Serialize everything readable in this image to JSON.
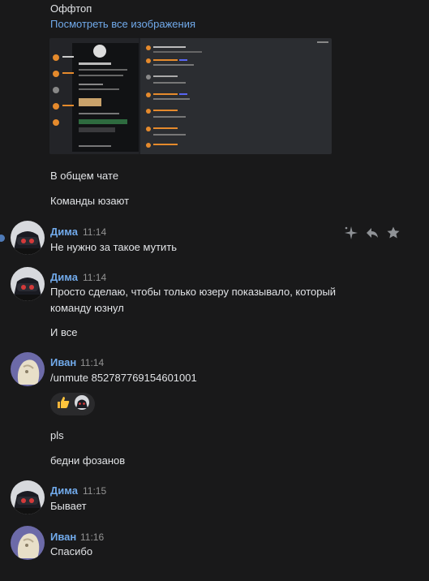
{
  "messages_top": {
    "offtopic": "Оффтоп",
    "view_all_images": "Посмотреть все изображения",
    "in_general_chat": "В общем чате",
    "commands_used": "Команды юзают"
  },
  "msg1": {
    "author": "Дима",
    "time": "11:14",
    "text": "Не нужно за такое мутить"
  },
  "msg2": {
    "author": "Дима",
    "time": "11:14",
    "line1": "Просто сделаю, чтобы только юзеру показывало, который",
    "line2": "команду юзнул",
    "extra": "И все"
  },
  "msg3": {
    "author": "Иван",
    "time": "11:14",
    "text": "/unmute 852787769154601001",
    "after1": "pls",
    "after2": "бедни фозанов"
  },
  "msg4": {
    "author": "Дима",
    "time": "11:15",
    "text": "Бывает"
  },
  "msg5": {
    "author": "Иван",
    "time": "11:16",
    "text": "Спасибо"
  },
  "reactions": [
    "thumbs-up",
    "dima-avatar"
  ],
  "hover_actions": [
    "sparkle-icon",
    "reply-icon",
    "favorite-icon"
  ],
  "colors": {
    "bg": "#19191a",
    "link": "#71aaeb",
    "text": "#e1e3e6",
    "time": "#939393"
  }
}
